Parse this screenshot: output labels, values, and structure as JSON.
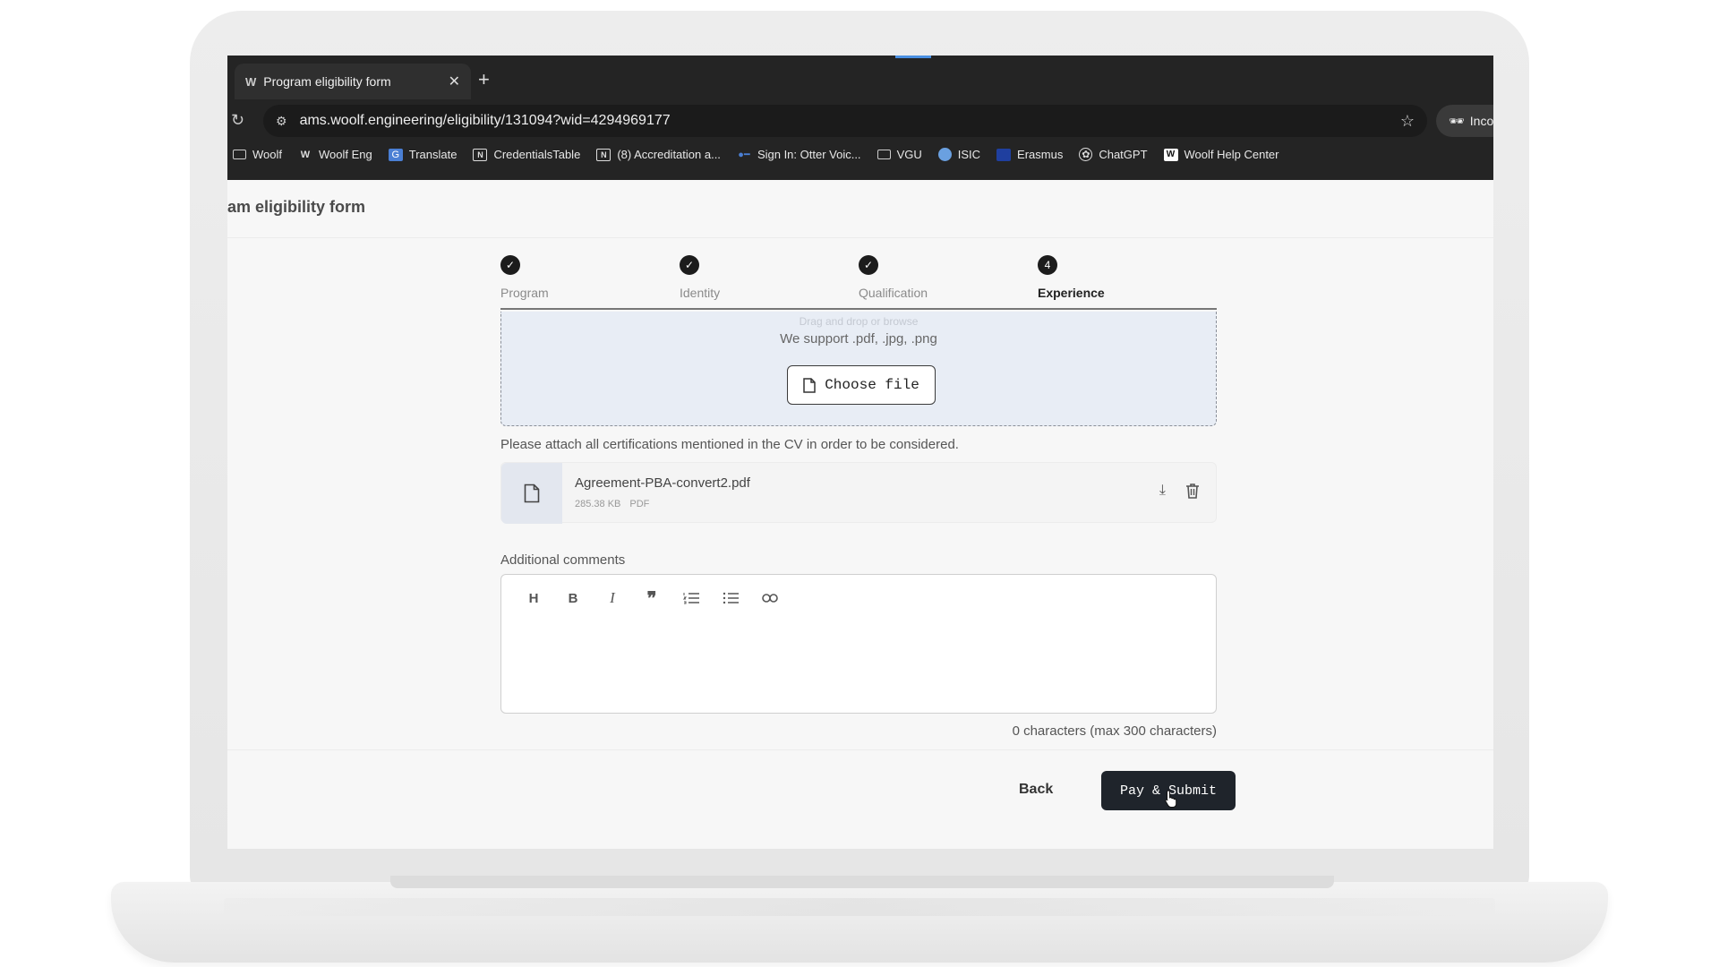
{
  "browser": {
    "tab_title": "Program eligibility form",
    "tab_favicon": "W",
    "new_tab_label": "+",
    "url": "ams.woolf.engineering/eligibility/131094?wid=4294969177",
    "incognito_label": "Incognito",
    "bookmarks": [
      {
        "label": "Woolf",
        "icon": "folder-icon"
      },
      {
        "label": "Woolf Eng",
        "icon": "woolf-icon"
      },
      {
        "label": "Translate",
        "icon": "translate-icon"
      },
      {
        "label": "CredentialsTable",
        "icon": "notion-icon"
      },
      {
        "label": "(8) Accreditation a...",
        "icon": "notion-icon"
      },
      {
        "label": "Sign In: Otter Voic...",
        "icon": "otter-icon"
      },
      {
        "label": "VGU",
        "icon": "folder-icon"
      },
      {
        "label": "ISIC",
        "icon": "isic-icon"
      },
      {
        "label": "Erasmus",
        "icon": "erasmus-icon"
      },
      {
        "label": "ChatGPT",
        "icon": "chatgpt-icon"
      },
      {
        "label": "Woolf Help Center",
        "icon": "woolf-icon"
      }
    ]
  },
  "page": {
    "title": "am eligibility form"
  },
  "stepper": {
    "steps": [
      {
        "label": "Program",
        "state": "done"
      },
      {
        "label": "Identity",
        "state": "done"
      },
      {
        "label": "Qualification",
        "state": "done"
      },
      {
        "label": "Experience",
        "state": "active",
        "number": "4"
      }
    ]
  },
  "upload": {
    "faded_text": "Drag and drop or browse",
    "support_text": "We support .pdf, .jpg, .png",
    "choose_label": "Choose file",
    "hint": "Please attach all certifications mentioned in the CV in order to be considered."
  },
  "file": {
    "name": "Agreement-PBA-convert2.pdf",
    "size": "285.38 KB",
    "type": "PDF"
  },
  "comments": {
    "label": "Additional comments",
    "toolbar": [
      "H",
      "B",
      "I",
      "quote",
      "ordered-list",
      "bullet-list",
      "link"
    ],
    "counter": "0 characters (max 300 characters)"
  },
  "footer": {
    "back_label": "Back",
    "submit_label": "Pay & Submit"
  },
  "colors": {
    "chrome_bg": "#242424",
    "primary_button": "#1f242b",
    "dropzone_bg": "#e8edf5"
  }
}
